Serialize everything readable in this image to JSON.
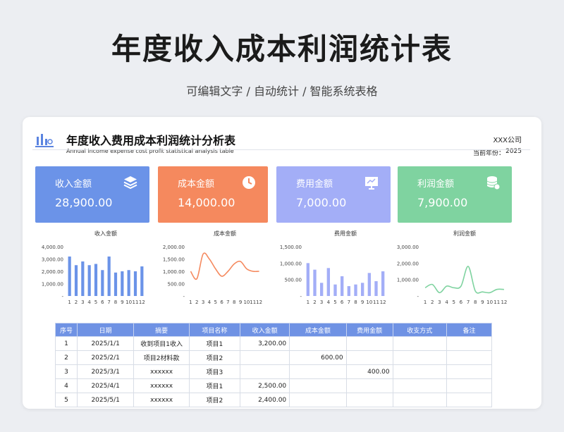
{
  "page": {
    "title": "年度收入成本利润统计表",
    "subtitle": "可编辑文字 / 自动统计 / 智能系统表格"
  },
  "sheet": {
    "title": "年度收入费用成本利润统计分析表",
    "title_en": "Annual income expense cost profit statistical analysis table",
    "company": "XXX公司",
    "year_label": "当前年份：",
    "year": "2025"
  },
  "kpis": [
    {
      "label": "收入金额",
      "value": "28,900.00",
      "color": "#6b93e8",
      "icon": "layers-icon"
    },
    {
      "label": "成本金额",
      "value": "14,000.00",
      "color": "#f5895e",
      "icon": "clock-icon"
    },
    {
      "label": "费用金额",
      "value": "7,000.00",
      "color": "#a3aef7",
      "icon": "presentation-icon"
    },
    {
      "label": "利润金额",
      "value": "7,900.00",
      "color": "#7fd3a0",
      "icon": "database-icon"
    }
  ],
  "chart_data": [
    {
      "type": "bar",
      "title": "收入金额",
      "categories": [
        "1",
        "2",
        "3",
        "4",
        "5",
        "6",
        "7",
        "8",
        "9",
        "10",
        "11",
        "12"
      ],
      "values": [
        3200,
        2500,
        2800,
        2500,
        2600,
        2100,
        3200,
        1900,
        2000,
        2100,
        2000,
        2400
      ],
      "ylim": [
        0,
        4000
      ],
      "ticks": [
        "4,000.00",
        "3,000.00",
        "2,000.00",
        "1,000.00",
        "-"
      ],
      "color": "#6b93e8"
    },
    {
      "type": "line",
      "title": "成本金额",
      "categories": [
        "1",
        "2",
        "3",
        "4",
        "5",
        "6",
        "7",
        "8",
        "9",
        "10",
        "11",
        "12"
      ],
      "values": [
        1000,
        700,
        1700,
        1500,
        1100,
        800,
        1000,
        1300,
        1400,
        1100,
        1000,
        1000
      ],
      "ylim": [
        0,
        2000
      ],
      "ticks": [
        "2,000.00",
        "1,500.00",
        "1,000.00",
        "500.00",
        "-"
      ],
      "color": "#f5895e"
    },
    {
      "type": "bar",
      "title": "费用金额",
      "categories": [
        "1",
        "2",
        "3",
        "4",
        "5",
        "6",
        "7",
        "8",
        "9",
        "10",
        "11",
        "12"
      ],
      "values": [
        1000,
        800,
        400,
        850,
        350,
        600,
        300,
        350,
        400,
        700,
        450,
        750
      ],
      "ylim": [
        0,
        1500
      ],
      "ticks": [
        "1,500.00",
        "1,000.00",
        "500.00",
        "-"
      ],
      "color": "#a3aef7"
    },
    {
      "type": "line",
      "title": "利润金额",
      "categories": [
        "1",
        "2",
        "3",
        "4",
        "5",
        "6",
        "7",
        "8",
        "9",
        "10",
        "11",
        "12"
      ],
      "values": [
        500,
        700,
        200,
        600,
        500,
        600,
        1800,
        300,
        250,
        200,
        400,
        400
      ],
      "ylim": [
        0,
        3000
      ],
      "ticks": [
        "3,000.00",
        "2,000.00",
        "1,000.00",
        "-"
      ],
      "color": "#7fd3a0"
    }
  ],
  "table": {
    "headers": [
      "序号",
      "日期",
      "摘要",
      "项目名称",
      "收入金额",
      "成本金额",
      "费用金额",
      "收支方式",
      "备注"
    ],
    "rows": [
      [
        "1",
        "2025/1/1",
        "收到项目1收入",
        "项目1",
        "3,200.00",
        "",
        "",
        "",
        ""
      ],
      [
        "2",
        "2025/2/1",
        "项目2材料款",
        "项目2",
        "",
        "600.00",
        "",
        "",
        ""
      ],
      [
        "3",
        "2025/3/1",
        "xxxxxx",
        "项目3",
        "",
        "",
        "400.00",
        "",
        ""
      ],
      [
        "4",
        "2025/4/1",
        "xxxxxx",
        "项目1",
        "2,500.00",
        "",
        "",
        "",
        ""
      ],
      [
        "5",
        "2025/5/1",
        "xxxxxx",
        "项目2",
        "2,400.00",
        "",
        "",
        "",
        ""
      ]
    ]
  }
}
